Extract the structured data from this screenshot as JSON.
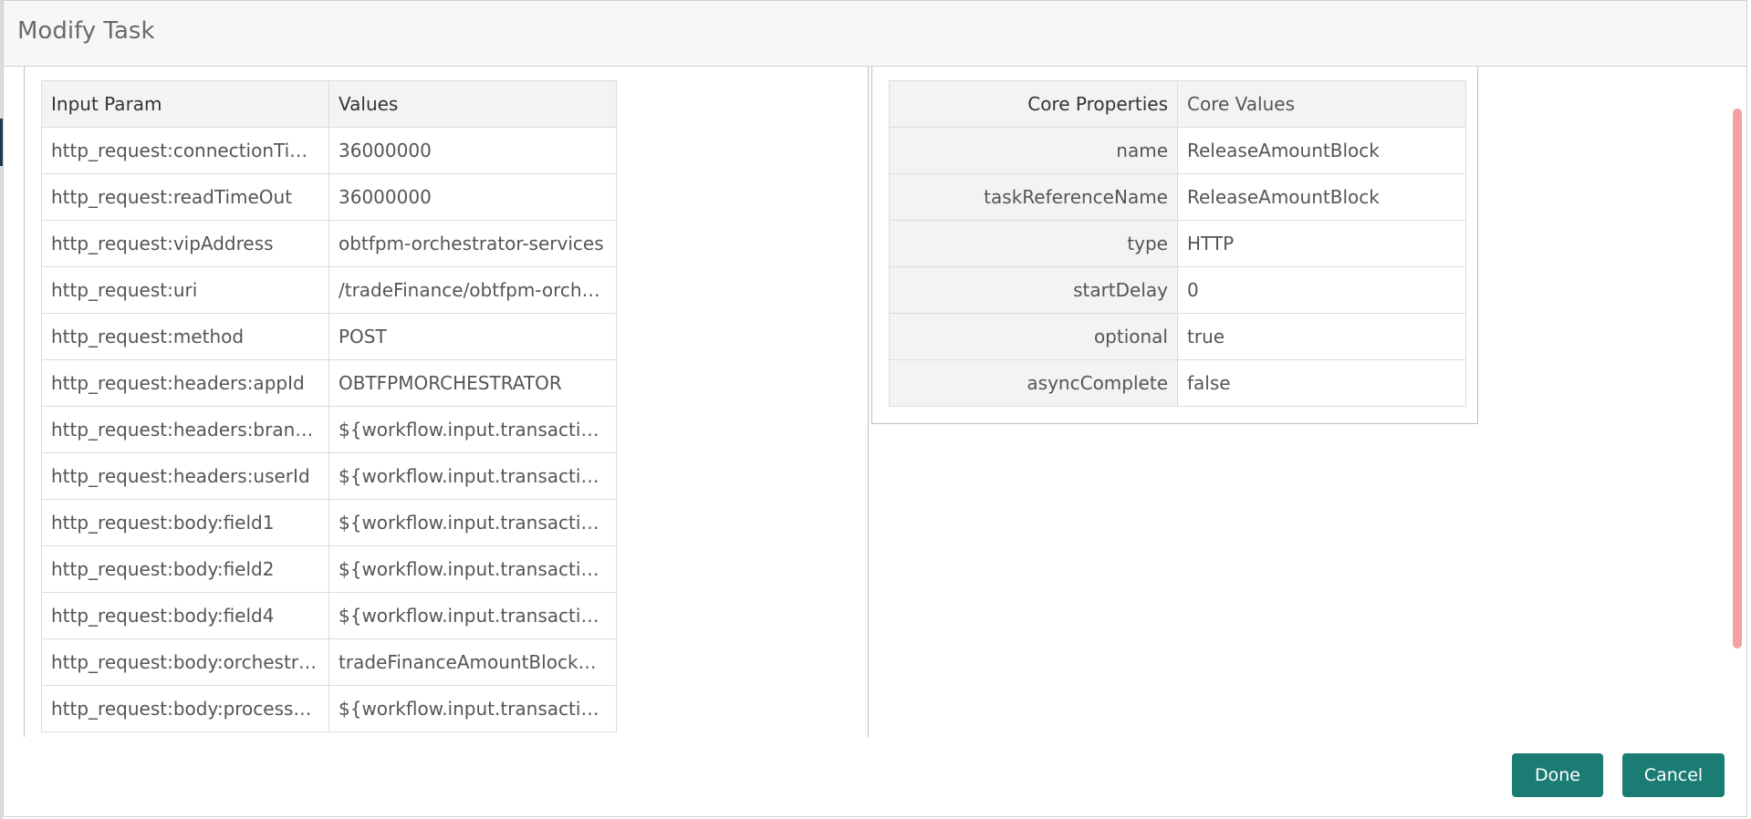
{
  "dialog": {
    "title": "Modify Task"
  },
  "input_params": {
    "headers": [
      "Input Param",
      "Values"
    ],
    "rows": [
      {
        "param": "http_request:connectionTime...",
        "value": "36000000"
      },
      {
        "param": "http_request:readTimeOut",
        "value": "36000000"
      },
      {
        "param": "http_request:vipAddress",
        "value": "obtfpm-orchestrator-services"
      },
      {
        "param": "http_request:uri",
        "value": "/tradeFinance/obtfpm-orches..."
      },
      {
        "param": "http_request:method",
        "value": "POST"
      },
      {
        "param": "http_request:headers:appId",
        "value": "OBTFPMORCHESTRATOR"
      },
      {
        "param": "http_request:headers:branchC...",
        "value": "${workflow.input.transaction..."
      },
      {
        "param": "http_request:headers:userId",
        "value": "${workflow.input.transaction..."
      },
      {
        "param": "http_request:body:field1",
        "value": "${workflow.input.transaction..."
      },
      {
        "param": "http_request:body:field2",
        "value": "${workflow.input.transaction..."
      },
      {
        "param": "http_request:body:field4",
        "value": "${workflow.input.transaction..."
      },
      {
        "param": "http_request:body:orchestrator",
        "value": "tradeFinanceAmountBlockClo..."
      },
      {
        "param": "http_request:body:processCode",
        "value": "${workflow.input.transaction..."
      }
    ]
  },
  "core_properties": {
    "headers": [
      "Core Properties",
      "Core Values"
    ],
    "rows": [
      {
        "key": "name",
        "value": "ReleaseAmountBlock"
      },
      {
        "key": "taskReferenceName",
        "value": "ReleaseAmountBlock"
      },
      {
        "key": "type",
        "value": "HTTP"
      },
      {
        "key": "startDelay",
        "value": "0"
      },
      {
        "key": "optional",
        "value": "true"
      },
      {
        "key": "asyncComplete",
        "value": "false"
      }
    ]
  },
  "footer": {
    "done_label": "Done",
    "cancel_label": "Cancel"
  },
  "colors": {
    "primary_button": "#1a7c73",
    "scrollbar_thumb": "#f4a0a0",
    "header_bg": "#f7f7f7"
  }
}
